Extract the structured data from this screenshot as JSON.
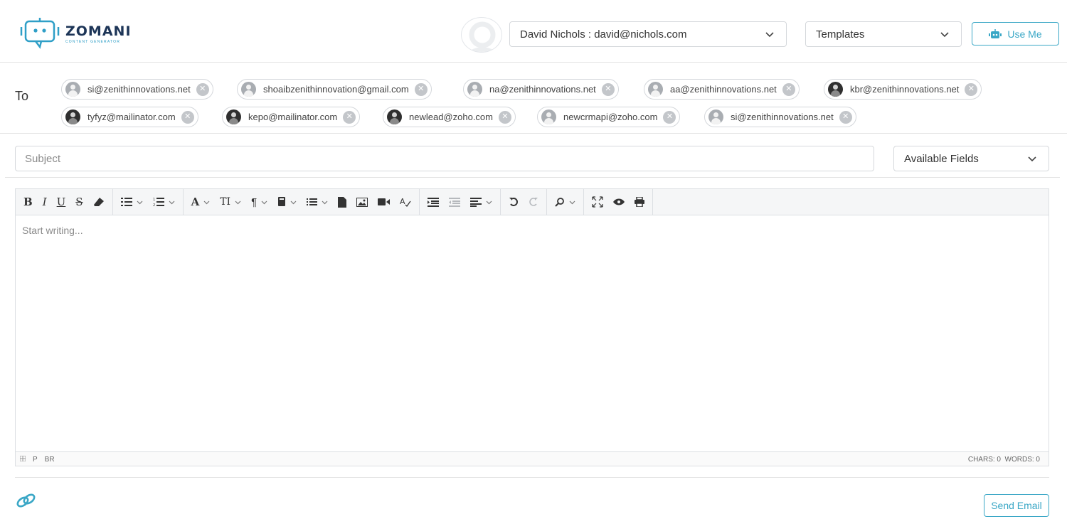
{
  "header": {
    "logo_name": "ZOMANI",
    "logo_subtitle": "CONTENT GENERATOR",
    "sender_value": "David Nichols : david@nichols.com",
    "templates_value": "Templates",
    "use_me_label": "Use Me",
    "accent_color": "#3aa7c6"
  },
  "to": {
    "label": "To",
    "recipients": [
      "si@zenithinnovations.net",
      "shoaibzenithinnovation@gmail.com",
      "na@zenithinnovations.net",
      "aa@zenithinnovations.net",
      "kbr@zenithinnovations.net",
      "tyfyz@mailinator.com",
      "kepo@mailinator.com",
      "newlead@zoho.com",
      "newcrmapi@zoho.com",
      "si@zenithinnovations.net"
    ]
  },
  "subject": {
    "placeholder": "Subject",
    "value": ""
  },
  "fields": {
    "label": "Available Fields"
  },
  "editor": {
    "placeholder": "Start writing...",
    "status_path": [
      "P",
      "BR"
    ],
    "counts": "CHARS: 0  WORDS: 0",
    "toolbar": {
      "bold": "B",
      "italic": "I",
      "underline": "U",
      "strike": "S",
      "font": "A",
      "font_size": "TI",
      "paragraph": "¶"
    }
  },
  "footer": {
    "send_label": "Send Email"
  }
}
